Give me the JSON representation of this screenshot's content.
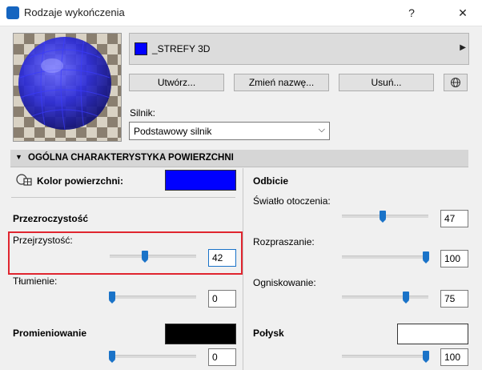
{
  "window": {
    "title": "Rodzaje wykończenia",
    "help": "?",
    "close": "✕"
  },
  "colors": {
    "surface": "#0000ff",
    "emission": "#000000",
    "gloss": "#ffffff",
    "accent": "#1a73c8"
  },
  "material": {
    "name": "_STREFY 3D"
  },
  "buttons": {
    "create": "Utwórz...",
    "rename": "Zmień nazwę...",
    "delete": "Usuń..."
  },
  "engine": {
    "label": "Silnik:",
    "value": "Podstawowy silnik"
  },
  "section": {
    "title": "OGÓLNA CHARAKTERYSTYKA POWIERZCHNI"
  },
  "left": {
    "surface_color_label": "Kolor powierzchni:",
    "transparency_header": "Przezroczystość",
    "transparency": {
      "label": "Przejrzystość:",
      "value": "42",
      "level": 0.42
    },
    "damping": {
      "label": "Tłumienie:",
      "value": "0",
      "level": 0
    },
    "emission": {
      "label": "Promieniowanie",
      "value": "0",
      "level": 0
    }
  },
  "right": {
    "reflection_header": "Odbicie",
    "ambient": {
      "label": "Światło otoczenia:",
      "value": "47",
      "level": 0.47
    },
    "diffuse": {
      "label": "Rozpraszanie:",
      "value": "100",
      "level": 1
    },
    "specular": {
      "label": "Ogniskowanie:",
      "value": "75",
      "level": 0.75
    },
    "gloss": {
      "label": "Połysk",
      "value": "100",
      "level": 1
    }
  }
}
